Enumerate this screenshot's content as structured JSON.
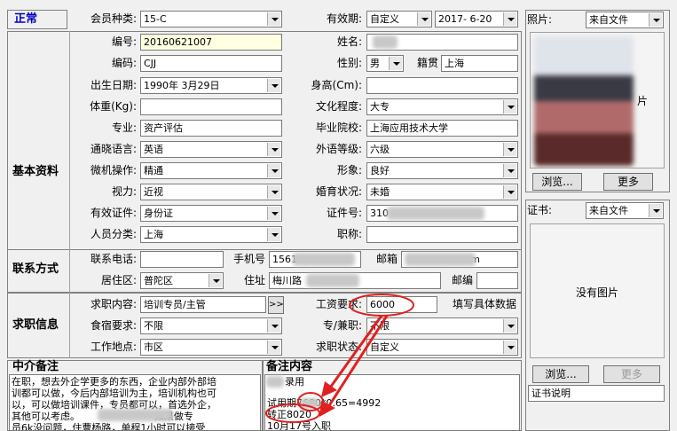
{
  "status": "正常",
  "member_type": {
    "label": "会员种类:",
    "value": "15-C"
  },
  "validity": {
    "label": "有效期:",
    "value": "自定义",
    "date": "2017- 6-20"
  },
  "photo": {
    "label": "照片:",
    "source": "来自文件",
    "browse": "浏览...",
    "more": "更多",
    "hidden_text": "片"
  },
  "cert": {
    "label": "证书:",
    "source": "来自文件",
    "no_image": "没有图片",
    "browse": "浏览...",
    "more": "更多",
    "note": "证书说明"
  },
  "sections": {
    "basic": "基本资料",
    "contact": "联系方式",
    "job": "求职信息",
    "agency_note": "中介备注",
    "remark": "备注内容"
  },
  "fields": {
    "number": {
      "label": "编号:",
      "value": "20160621007"
    },
    "name": {
      "label": "姓名:",
      "value": ""
    },
    "code": {
      "label": "编码:",
      "value": "CJJ"
    },
    "gender": {
      "label": "性别:",
      "value": "男"
    },
    "native": {
      "label": "籍贯",
      "value": "上海"
    },
    "birth": {
      "label": "出生日期:",
      "value": "1990年 3月29日"
    },
    "height": {
      "label": "身高(Cm):",
      "value": ""
    },
    "weight": {
      "label": "体重(Kg):",
      "value": ""
    },
    "education": {
      "label": "文化程度:",
      "value": "大专"
    },
    "major": {
      "label": "专业:",
      "value": "资产评估"
    },
    "school": {
      "label": "毕业院校:",
      "value": "上海应用技术大学"
    },
    "language": {
      "label": "通晓语言:",
      "value": "英语"
    },
    "foreign_level": {
      "label": "外语等级:",
      "value": "六级"
    },
    "computer": {
      "label": "微机操作:",
      "value": "精通"
    },
    "image": {
      "label": "形象:",
      "value": "良好"
    },
    "vision": {
      "label": "视力:",
      "value": "近视"
    },
    "marriage": {
      "label": "婚育状况:",
      "value": "未婚"
    },
    "id_type": {
      "label": "有效证件:",
      "value": "身份证"
    },
    "id_no": {
      "label": "证件号:",
      "value": "310"
    },
    "category": {
      "label": "人员分类:",
      "value": "上海"
    },
    "title": {
      "label": "职称:",
      "value": ""
    },
    "phone": {
      "label": "联系电话:",
      "value": ""
    },
    "mobile": {
      "label": "手机号",
      "value": "1561"
    },
    "email": {
      "label": "邮箱",
      "value": "m"
    },
    "district": {
      "label": "居住区:",
      "value": "普陀区"
    },
    "address": {
      "label": "住址",
      "value": "梅川路"
    },
    "postcode": {
      "label": "邮编",
      "value": ""
    },
    "job_content": {
      "label": "求职内容:",
      "value": "培训专员/主管",
      "arrow": ">>"
    },
    "salary": {
      "label": "工资要求:",
      "value": "6000",
      "hint": "填写具体数据"
    },
    "lodging": {
      "label": "食宿要求:",
      "value": "不限"
    },
    "fulltime": {
      "label": "专/兼职:",
      "value": "不限"
    },
    "workplace": {
      "label": "工作地点:",
      "value": "市区"
    },
    "job_status": {
      "label": "求职状态:",
      "value": "自定义"
    }
  },
  "agency_text": [
    "在职，想去外企学更多的东西，企业内部外部培",
    "训都可以做，今后内部培训为主，培训机构也可",
    "以，可以做培训课件，专员都可以，首选外企，",
    "其他可以考虑。                        如果做专",
    "员6k没问题，住曹杨路，单程1小时可以接受"
  ],
  "remark_text": [
    "录用",
    "试用期7680*0.65=4992",
    "转正8020",
    "10月17号入职"
  ]
}
